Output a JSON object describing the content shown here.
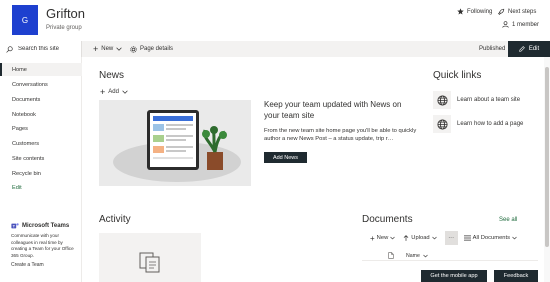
{
  "header": {
    "logo_letter": "G",
    "site_title": "Grifton",
    "site_subtitle": "Private group",
    "following_label": "Following",
    "next_steps_label": "Next steps",
    "member_label": "1 member"
  },
  "commandbar": {
    "search_placeholder": "Search this site",
    "new_label": "New",
    "page_details_label": "Page details",
    "published_label": "Published",
    "edit_label": "Edit"
  },
  "leftnav": {
    "items": [
      {
        "label": "Home",
        "active": true
      },
      {
        "label": "Conversations"
      },
      {
        "label": "Documents"
      },
      {
        "label": "Notebook"
      },
      {
        "label": "Pages"
      },
      {
        "label": "Customers"
      },
      {
        "label": "Site contents"
      },
      {
        "label": "Recycle bin"
      },
      {
        "label": "Edit"
      }
    ],
    "teams": {
      "title": "Microsoft Teams",
      "text": "Communicate with your colleagues in real time by creating a Team for your Office 365 Group.",
      "link": "Create a Team"
    }
  },
  "news": {
    "title": "News",
    "add_label": "Add",
    "headline": "Keep your team updated with News on your team site",
    "description": "From the new team site home page you'll be able to quickly author a new News Post – a status update, trip r…",
    "add_news_label": "Add News"
  },
  "quick_links": {
    "title": "Quick links",
    "items": [
      {
        "label": "Learn about a team site",
        "icon": "globe-icon"
      },
      {
        "label": "Learn how to add a page",
        "icon": "globe-icon"
      }
    ]
  },
  "activity": {
    "title": "Activity"
  },
  "documents": {
    "title": "Documents",
    "see_all_label": "See all",
    "new_label": "New",
    "upload_label": "Upload",
    "more_label": "···",
    "view_label": "All Documents",
    "name_column": "Name"
  },
  "footer": {
    "mobile_app_label": "Get the mobile app",
    "feedback_label": "Feedback"
  },
  "colors": {
    "logo_bg": "#1e40cf",
    "dark_button": "#1f2a30",
    "accent_link": "#1e6a3c"
  }
}
